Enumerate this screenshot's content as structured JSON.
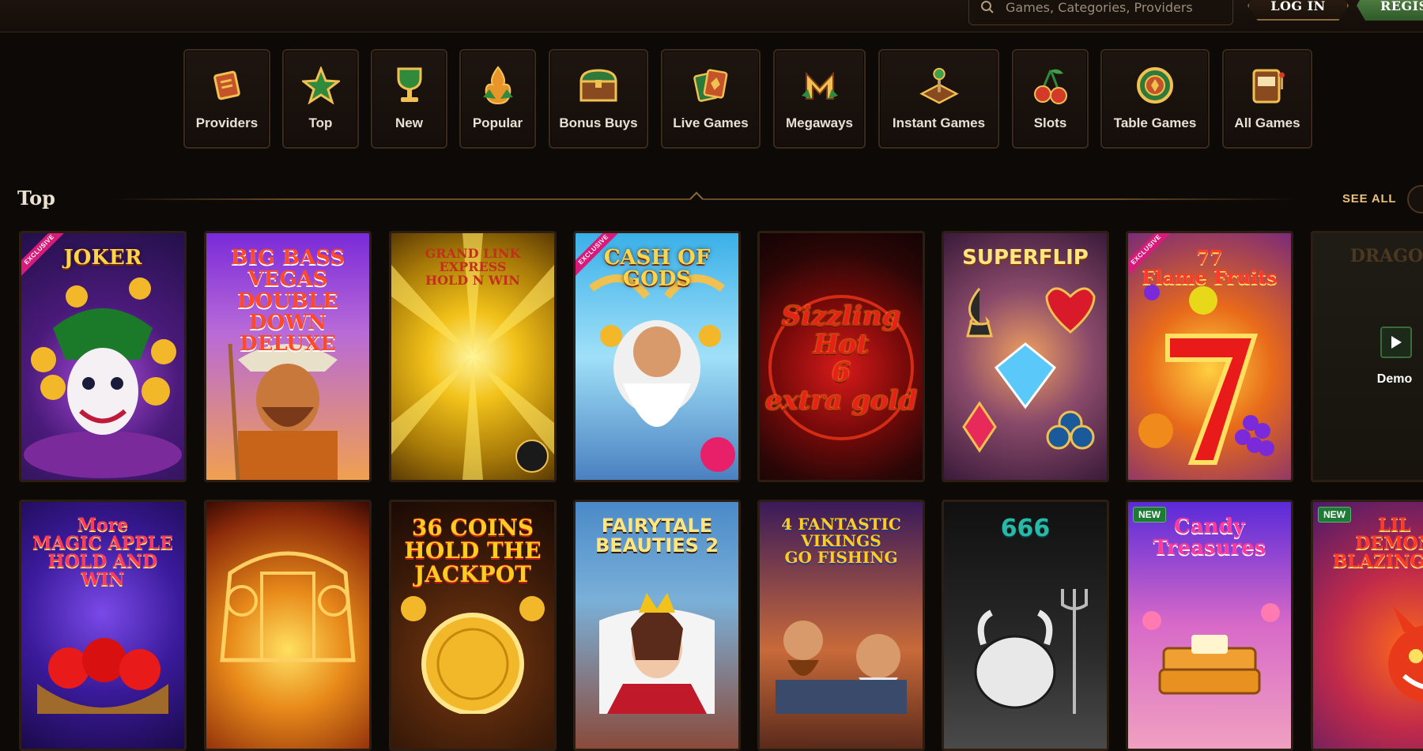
{
  "header": {
    "search_placeholder": "Games, Categories, Providers",
    "login_label": "LOG IN",
    "register_label": "REGIS"
  },
  "categories": [
    {
      "label": "Providers",
      "icon": "scroll-icon"
    },
    {
      "label": "Top",
      "icon": "star-icon"
    },
    {
      "label": "New",
      "icon": "chalice-icon"
    },
    {
      "label": "Popular",
      "icon": "flame-gem-icon"
    },
    {
      "label": "Bonus Buys",
      "icon": "treasure-chest-icon"
    },
    {
      "label": "Live Games",
      "icon": "cards-icon"
    },
    {
      "label": "Megaways",
      "icon": "megaways-m-icon"
    },
    {
      "label": "Instant Games",
      "icon": "joystick-icon"
    },
    {
      "label": "Slots",
      "icon": "cherries-icon"
    },
    {
      "label": "Table Games",
      "icon": "chip-icon"
    },
    {
      "label": "All Games",
      "icon": "slot-machine-icon"
    }
  ],
  "section": {
    "title": "Top",
    "see_all": "SEE ALL"
  },
  "games_row1": [
    {
      "title": "JOKER",
      "ribbon": "EXCLUSIVE"
    },
    {
      "title": "BIG BASS\nVEGAS\nDOUBLE DOWN\nDELUXE"
    },
    {
      "title": "GRAND LINK\nEXPRESS\nHOLD N WIN"
    },
    {
      "title": "CASH OF\nGODS",
      "ribbon": "EXCLUSIVE"
    },
    {
      "title": "Sizzling\nHot\n6\nextra gold"
    },
    {
      "title": "SUPERFLIP"
    },
    {
      "title": "77\nFlame Fruits",
      "ribbon": "EXCLUSIVE"
    },
    {
      "title": "DRAGON",
      "demo": "Demo"
    }
  ],
  "games_row2": [
    {
      "title": "More\nMAGIC APPLE\nHOLD AND WIN"
    },
    {
      "title": ""
    },
    {
      "title": "36 COINS\nHOLD THE JACKPOT"
    },
    {
      "title": "FAIRYTALE\nBEAUTIES 2"
    },
    {
      "title": "4 FANTASTIC\nVIKINGS\nGO FISHING"
    },
    {
      "title": "666"
    },
    {
      "title": "Candy\nTreasures",
      "badge": "NEW"
    },
    {
      "title": "LIL\nDEMON\nBLAZING LA",
      "badge": "NEW"
    }
  ]
}
